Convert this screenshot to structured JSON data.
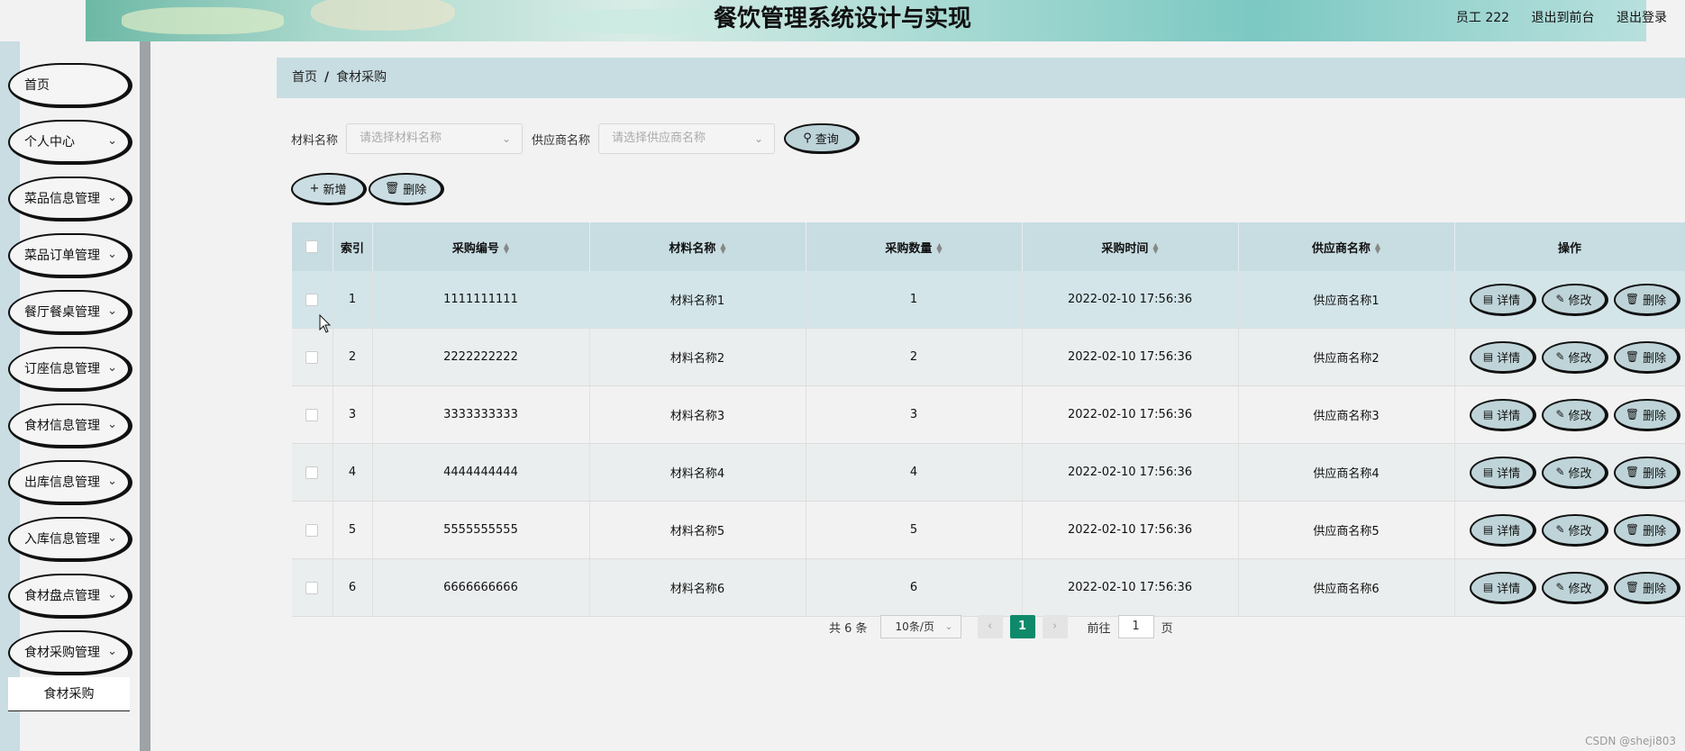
{
  "header": {
    "title": "餐饮管理系统设计与实现",
    "user": "员工 222",
    "exit_front": "退出到前台",
    "logout": "退出登录"
  },
  "sidebar": {
    "items": [
      {
        "label": "首页",
        "has_arrow": false
      },
      {
        "label": "个人中心",
        "has_arrow": true
      },
      {
        "label": "菜品信息管理",
        "has_arrow": true
      },
      {
        "label": "菜品订单管理",
        "has_arrow": true
      },
      {
        "label": "餐厅餐桌管理",
        "has_arrow": true
      },
      {
        "label": "订座信息管理",
        "has_arrow": true
      },
      {
        "label": "食材信息管理",
        "has_arrow": true
      },
      {
        "label": "出库信息管理",
        "has_arrow": true
      },
      {
        "label": "入库信息管理",
        "has_arrow": true
      },
      {
        "label": "食材盘点管理",
        "has_arrow": true
      },
      {
        "label": "食材采购管理",
        "has_arrow": true
      }
    ],
    "submenu": "食材采购"
  },
  "breadcrumb": {
    "home": "首页",
    "sep": "/",
    "current": "食材采购"
  },
  "search": {
    "material_label": "材料名称",
    "material_placeholder": "请选择材料名称",
    "supplier_label": "供应商名称",
    "supplier_placeholder": "请选择供应商名称",
    "query_button": "查询"
  },
  "actions": {
    "add": "新增",
    "delete": "删除"
  },
  "table": {
    "headers": {
      "index": "索引",
      "code": "采购编号",
      "material": "材料名称",
      "qty": "采购数量",
      "time": "采购时间",
      "supplier": "供应商名称",
      "ops": "操作"
    },
    "rows": [
      {
        "index": "1",
        "code": "1111111111",
        "material": "材料名称1",
        "qty": "1",
        "time": "2022-02-10 17:56:36",
        "supplier": "供应商名称1"
      },
      {
        "index": "2",
        "code": "2222222222",
        "material": "材料名称2",
        "qty": "2",
        "time": "2022-02-10 17:56:36",
        "supplier": "供应商名称2"
      },
      {
        "index": "3",
        "code": "3333333333",
        "material": "材料名称3",
        "qty": "3",
        "time": "2022-02-10 17:56:36",
        "supplier": "供应商名称3"
      },
      {
        "index": "4",
        "code": "4444444444",
        "material": "材料名称4",
        "qty": "4",
        "time": "2022-02-10 17:56:36",
        "supplier": "供应商名称4"
      },
      {
        "index": "5",
        "code": "5555555555",
        "material": "材料名称5",
        "qty": "5",
        "time": "2022-02-10 17:56:36",
        "supplier": "供应商名称5"
      },
      {
        "index": "6",
        "code": "6666666666",
        "material": "材料名称6",
        "qty": "6",
        "time": "2022-02-10 17:56:36",
        "supplier": "供应商名称6"
      }
    ],
    "row_buttons": {
      "detail": "详情",
      "edit": "修改",
      "delete": "删除"
    }
  },
  "pagination": {
    "total": "共 6 条",
    "page_size": "10条/页",
    "current_page": "1",
    "goto_label": "前往",
    "goto_value": "1",
    "page_suffix": "页"
  },
  "watermark": "CSDN @sheji803",
  "colors": {
    "accent": "#0e8a6a",
    "header_bg": "#c8dde2",
    "button_bg": "#bcd3d8"
  }
}
